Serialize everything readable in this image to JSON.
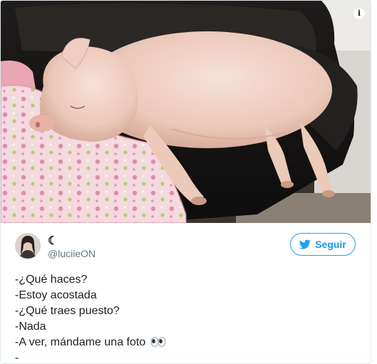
{
  "photo": {
    "description_icon": "info-icon",
    "info_label": "i"
  },
  "author": {
    "display_name": "☾",
    "screen_name": "@luciieON",
    "avatar_icon": "avatar"
  },
  "follow_button": {
    "label": "Seguir",
    "icon": "twitter-bird-icon",
    "color": "#1da1f2"
  },
  "tweet": {
    "lines": [
      "-¿Qué haces?",
      "-Estoy acostada",
      "-¿Qué traes puesto?",
      "-Nada",
      "-A ver, mándame una foto",
      "-"
    ],
    "emoji": "eyes-emoji"
  }
}
